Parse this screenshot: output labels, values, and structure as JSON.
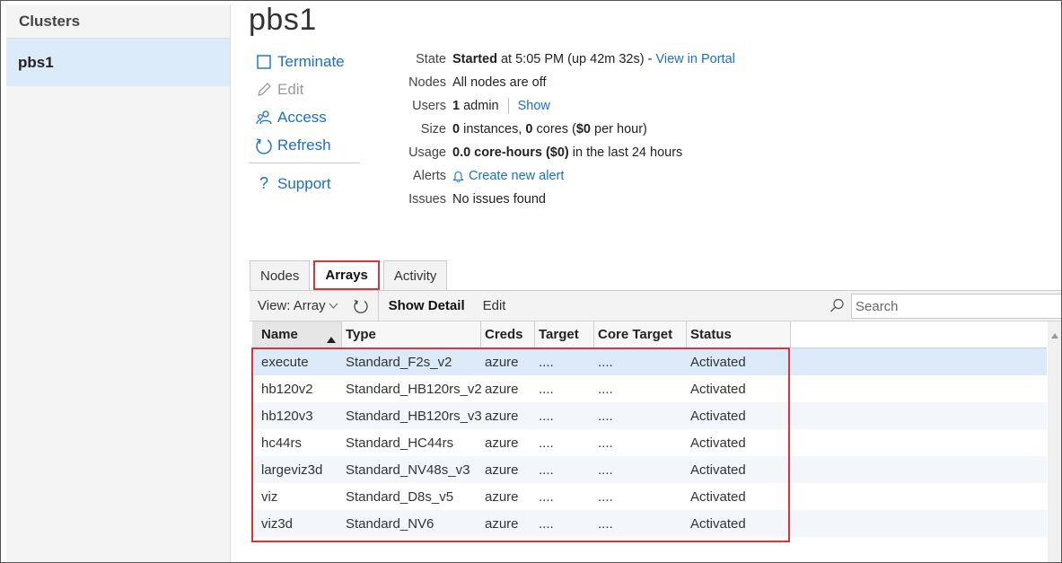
{
  "sidebar": {
    "title": "Clusters",
    "items": [
      {
        "label": "pbs1"
      }
    ]
  },
  "page": {
    "title": "pbs1"
  },
  "actions": {
    "terminate": "Terminate",
    "edit": "Edit",
    "access": "Access",
    "refresh": "Refresh",
    "support": "Support"
  },
  "info": {
    "state_label": "State",
    "state_value": "Started",
    "state_detail": " at 5:05 PM (up 42m 32s) - ",
    "state_link": "View in Portal",
    "nodes_label": "Nodes",
    "nodes_value": "All nodes are off",
    "users_label": "Users",
    "users_count": "1",
    "users_role": " admin",
    "users_link": "Show",
    "size_label": "Size",
    "size_instances": "0",
    "size_instances_text": " instances, ",
    "size_cores": "0",
    "size_cores_text": " cores (",
    "size_cost": "$0",
    "size_cost_text": " per hour)",
    "usage_label": "Usage",
    "usage_value": "0.0 core-hours ($0)",
    "usage_text": " in the last 24 hours",
    "alerts_label": "Alerts",
    "alerts_link": "Create new alert",
    "issues_label": "Issues",
    "issues_value": "No issues found"
  },
  "tabs": [
    {
      "label": "Nodes"
    },
    {
      "label": "Arrays"
    },
    {
      "label": "Activity"
    }
  ],
  "toolbar": {
    "view_label": "View: Array",
    "show_detail": "Show Detail",
    "edit": "Edit",
    "search_placeholder": "Search"
  },
  "grid": {
    "columns": [
      "Name",
      "Type",
      "Creds",
      "Target",
      "Core Target",
      "Status"
    ],
    "rows": [
      {
        "name": "execute",
        "type": "Standard_F2s_v2",
        "creds": "azure",
        "target": "....",
        "core_target": "....",
        "status": "Activated"
      },
      {
        "name": "hb120v2",
        "type": "Standard_HB120rs_v2",
        "creds": "azure",
        "target": "....",
        "core_target": "....",
        "status": "Activated"
      },
      {
        "name": "hb120v3",
        "type": "Standard_HB120rs_v3",
        "creds": "azure",
        "target": "....",
        "core_target": "....",
        "status": "Activated"
      },
      {
        "name": "hc44rs",
        "type": "Standard_HC44rs",
        "creds": "azure",
        "target": "....",
        "core_target": "....",
        "status": "Activated"
      },
      {
        "name": "largeviz3d",
        "type": "Standard_NV48s_v3",
        "creds": "azure",
        "target": "....",
        "core_target": "....",
        "status": "Activated"
      },
      {
        "name": "viz",
        "type": "Standard_D8s_v5",
        "creds": "azure",
        "target": "....",
        "core_target": "....",
        "status": "Activated"
      },
      {
        "name": "viz3d",
        "type": "Standard_NV6",
        "creds": "azure",
        "target": "....",
        "core_target": "....",
        "status": "Activated"
      }
    ]
  },
  "colors": {
    "link": "#1a6fc4",
    "highlight": "#d9333f",
    "selected_row": "#dbe9f8"
  }
}
